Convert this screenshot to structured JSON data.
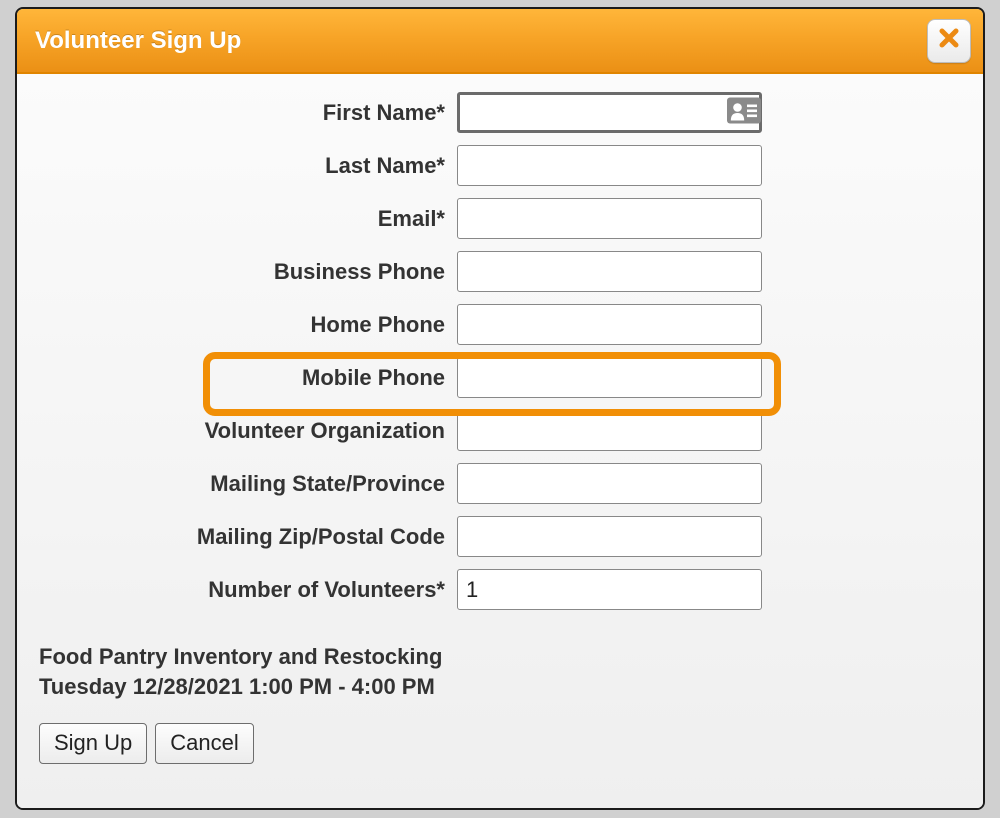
{
  "modal": {
    "title": "Volunteer Sign Up"
  },
  "form": {
    "first_name": {
      "label": "First Name*",
      "value": ""
    },
    "last_name": {
      "label": "Last Name*",
      "value": ""
    },
    "email": {
      "label": "Email*",
      "value": ""
    },
    "business_phone": {
      "label": "Business Phone",
      "value": ""
    },
    "home_phone": {
      "label": "Home Phone",
      "value": ""
    },
    "mobile_phone": {
      "label": "Mobile Phone",
      "value": ""
    },
    "volunteer_org": {
      "label": "Volunteer Organization",
      "value": ""
    },
    "mailing_state": {
      "label": "Mailing State/Province",
      "value": ""
    },
    "mailing_zip": {
      "label": "Mailing Zip/Postal Code",
      "value": ""
    },
    "num_volunteers": {
      "label": "Number of Volunteers*",
      "value": "1"
    }
  },
  "event": {
    "name": "Food Pantry Inventory and Restocking",
    "schedule": "Tuesday 12/28/2021 1:00 PM - 4:00 PM"
  },
  "buttons": {
    "signup": "Sign Up",
    "cancel": "Cancel"
  }
}
